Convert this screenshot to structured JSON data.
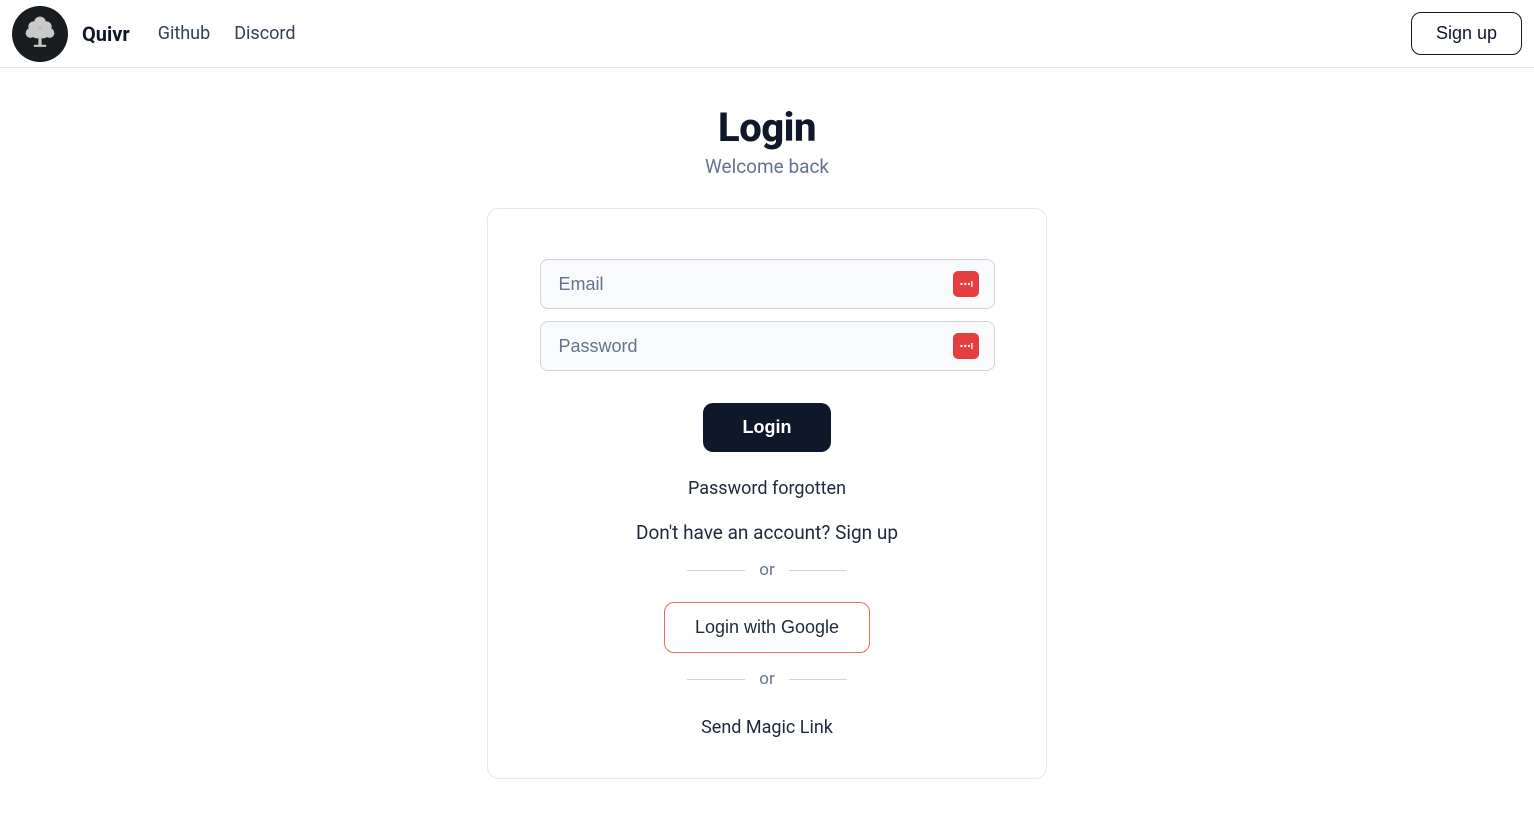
{
  "header": {
    "brand_name": "Quivr",
    "logo_icon": "tree-icon",
    "nav_links": [
      "Github",
      "Discord"
    ],
    "signup_label": "Sign up"
  },
  "page": {
    "title": "Login",
    "subtitle": "Welcome back"
  },
  "form": {
    "email_placeholder": "Email",
    "email_value": "",
    "password_placeholder": "Password",
    "password_value": "",
    "login_button": "Login",
    "forgot_password": "Password forgotten",
    "signup_prompt_prefix": "Don't have an account? ",
    "signup_prompt_link": "Sign up",
    "divider_text": "or",
    "google_button": "Login with Google",
    "magic_link": "Send Magic Link",
    "password_manager_icon": "password-manager-icon"
  }
}
